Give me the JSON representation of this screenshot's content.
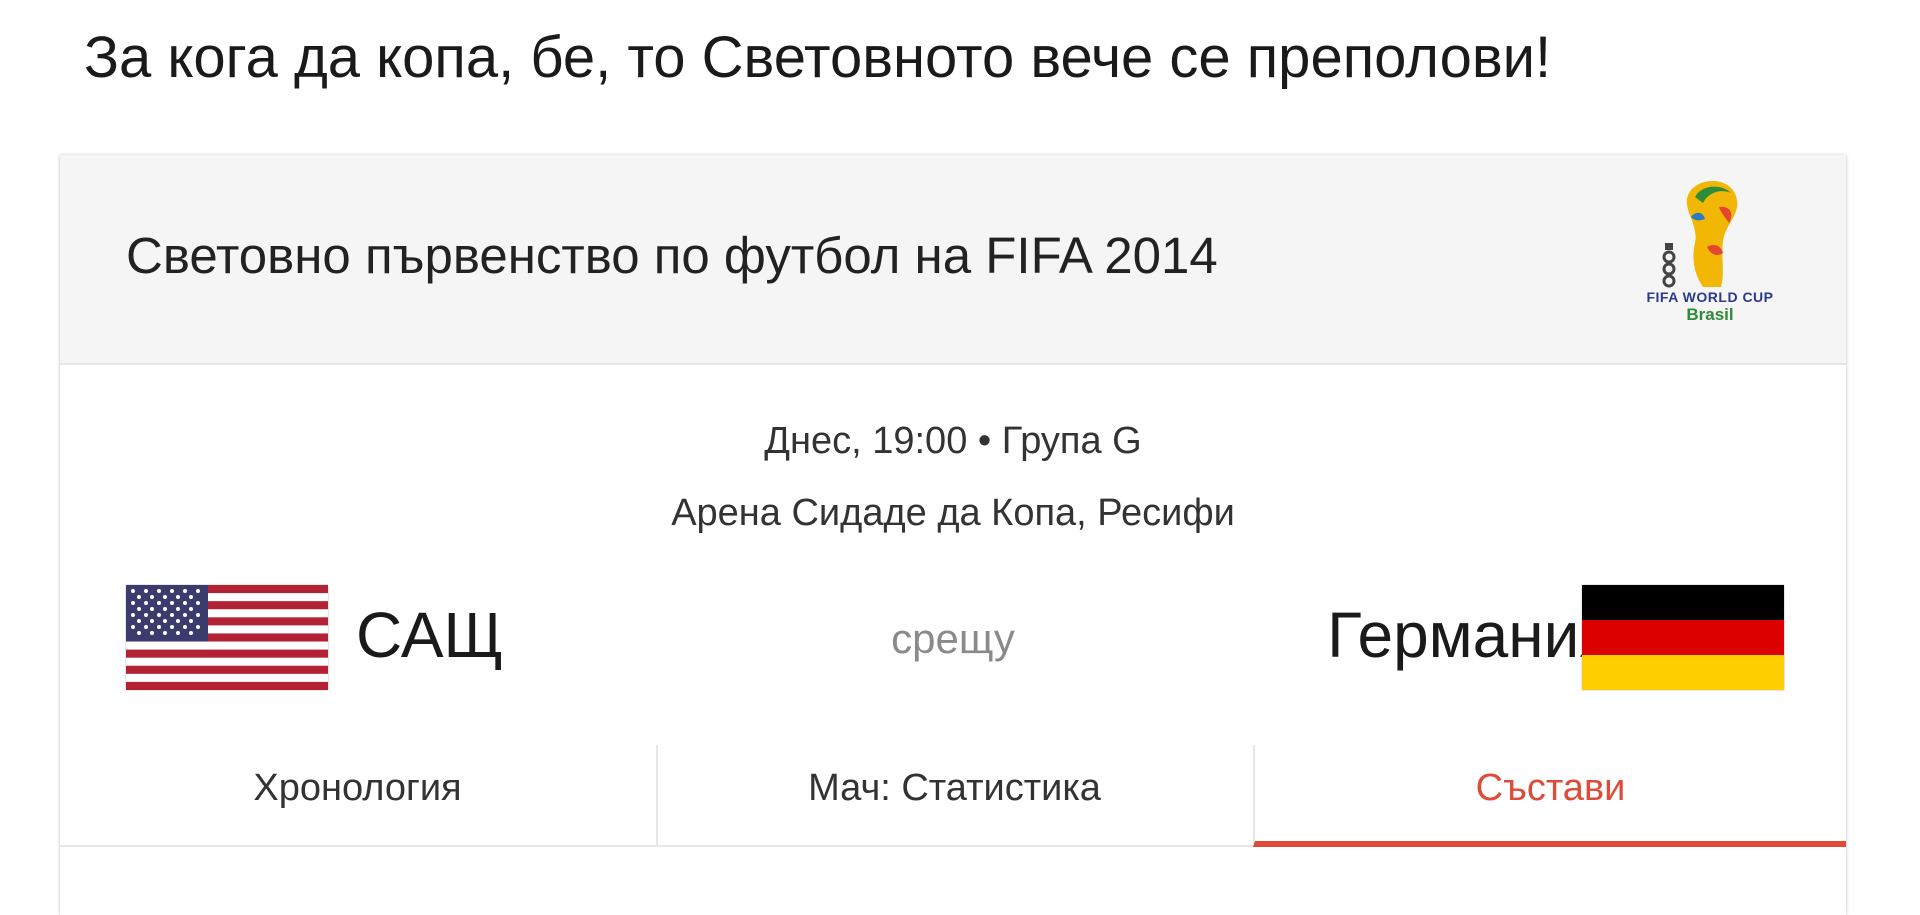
{
  "caption": "За кога да копа, бе, то Световното вече се преполови!",
  "card": {
    "title": "Световно първенство по футбол на FIFA 2014",
    "logo": {
      "icon": "fifa-world-cup-2014-logo",
      "line1": "FIFA WORLD CUP",
      "line2": "Brasil"
    }
  },
  "match": {
    "datetime_group": "Днес, 19:00 • Група G",
    "venue": "Арена Сидаде да Копа, Ресифи",
    "home_team": "САЩ",
    "away_team": "Германия",
    "versus": "срещу",
    "home_flag": "usa-flag-icon",
    "away_flag": "germany-flag-icon"
  },
  "tabs": [
    {
      "label": "Хронология",
      "active": false
    },
    {
      "label": "Мач: Статистика",
      "active": false
    },
    {
      "label": "Състави",
      "active": true
    }
  ],
  "colors": {
    "accent": "#dd4b39",
    "header_bg": "#f5f5f5",
    "divider": "#e6e6e6"
  }
}
